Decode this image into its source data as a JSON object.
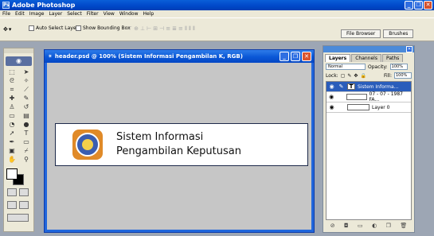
{
  "app": {
    "title": "Adobe Photoshop"
  },
  "menu": [
    "File",
    "Edit",
    "Image",
    "Layer",
    "Select",
    "Filter",
    "View",
    "Window",
    "Help"
  ],
  "options": {
    "auto_select_label": "Auto Select Layer",
    "show_bounding_label": "Show Bounding Box",
    "tab_file_browser": "File Browser",
    "tab_brushes": "Brushes"
  },
  "document": {
    "title": "header.psd @ 100% (Sistem Informasi Pengambilan K, RGB)",
    "banner_line1": "Sistem Informasi",
    "banner_line2": "Pengambilan Keputusan"
  },
  "layers_panel": {
    "tabs": [
      "Layers",
      "Channels",
      "Paths"
    ],
    "blend_mode": "Normal",
    "opacity_label": "Opacity:",
    "opacity_value": "100%",
    "lock_label": "Lock:",
    "fill_label": "Fill:",
    "fill_value": "100%",
    "layers": [
      {
        "name": "Sistem Informa...",
        "selected": true
      },
      {
        "name": "07 - 07 - 1987 FA...",
        "selected": false
      },
      {
        "name": "Layer 0",
        "selected": false
      }
    ]
  }
}
